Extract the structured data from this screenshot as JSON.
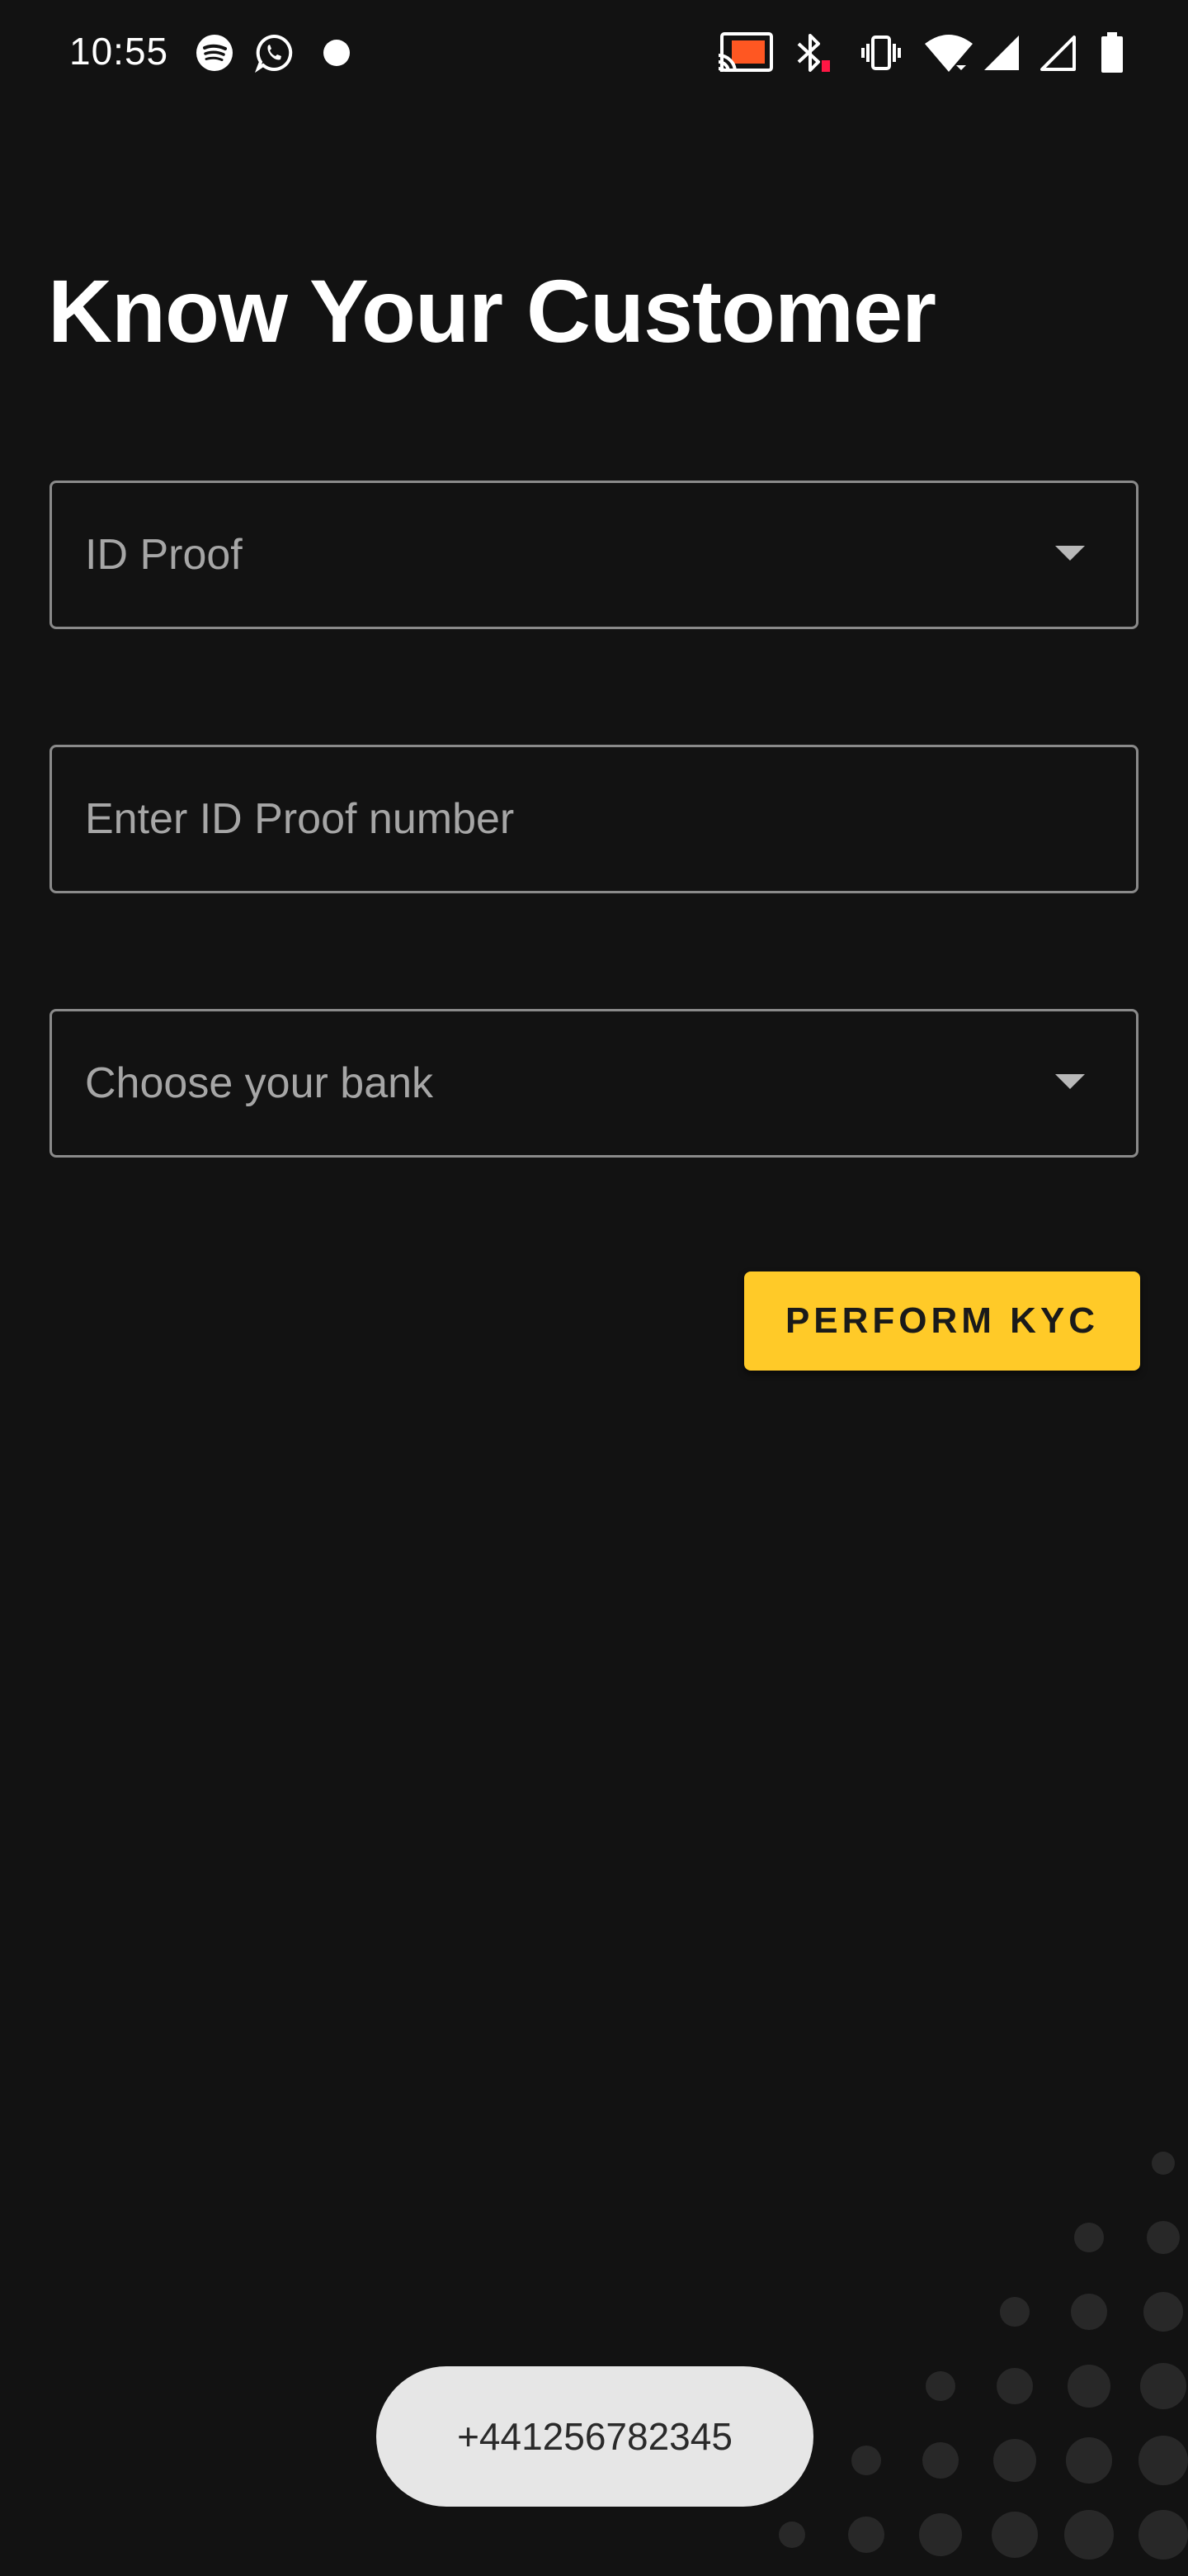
{
  "status_bar": {
    "time": "10:55",
    "left_icons": [
      "spotify-icon",
      "whatsapp-icon",
      "notification-dot-icon"
    ],
    "right_icons": [
      "cast-icon",
      "bluetooth-icon",
      "vibrate-icon",
      "wifi-icon",
      "signal-icon",
      "signal-empty-icon",
      "battery-icon"
    ],
    "cast_accent_color": "#ff5722",
    "bluetooth_low_battery_color": "#ff1744"
  },
  "page": {
    "title": "Know Your Customer"
  },
  "form": {
    "id_proof_dropdown": {
      "placeholder": "ID Proof"
    },
    "id_number_input": {
      "placeholder": "Enter ID Proof number"
    },
    "bank_dropdown": {
      "placeholder": "Choose your bank"
    },
    "submit_label": "PERFORM KYC",
    "submit_color": "#ffca28"
  },
  "toast": {
    "message": "+441256782345"
  },
  "theme": {
    "background": "#121212",
    "border": "#8a8a8a",
    "placeholder_text": "#a6a6a6"
  }
}
